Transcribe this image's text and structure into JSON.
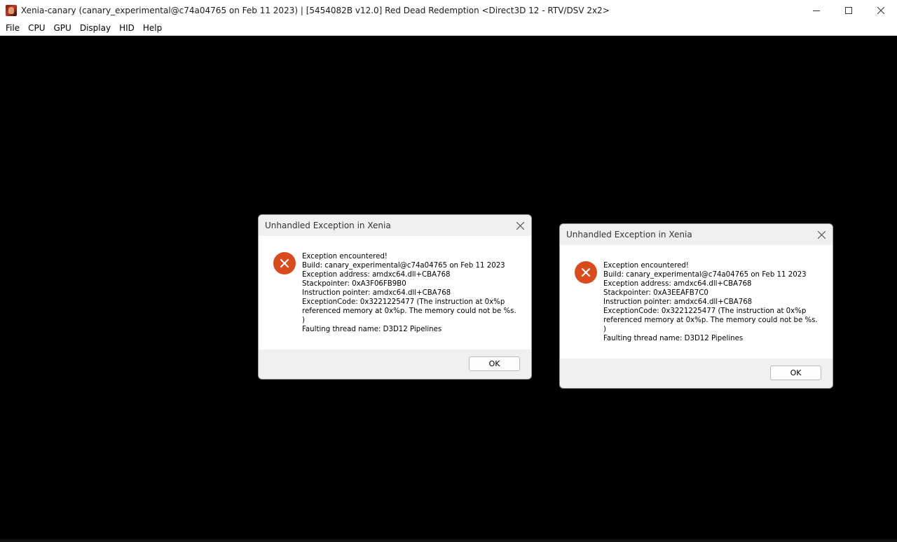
{
  "window": {
    "title": "Xenia-canary (canary_experimental@c74a04765 on Feb 11 2023) | [5454082B v12.0] Red Dead Redemption <Direct3D 12 - RTV/DSV 2x2>",
    "icon": "red-dead-redemption-app-icon"
  },
  "menu": {
    "items": [
      "File",
      "CPU",
      "GPU",
      "Display",
      "HID",
      "Help"
    ]
  },
  "dialogs": [
    {
      "title": "Unhandled Exception in Xenia",
      "icon": "error-icon",
      "lines": [
        "Exception encountered!",
        "Build: canary_experimental@c74a04765 on Feb 11 2023",
        "Exception address: amdxc64.dll+CBA768",
        "Stackpointer: 0xA3F06FB9B0",
        "Instruction pointer: amdxc64.dll+CBA768",
        "ExceptionCode: 0x3221225477 (The instruction at 0x%p",
        "referenced memory at 0x%p. The memory could not be %s.",
        ")",
        "Faulting thread name: D3D12 Pipelines"
      ],
      "ok_label": "OK"
    },
    {
      "title": "Unhandled Exception in Xenia",
      "icon": "error-icon",
      "lines": [
        "Exception encountered!",
        "Build: canary_experimental@c74a04765 on Feb 11 2023",
        "Exception address: amdxc64.dll+CBA768",
        "Stackpointer: 0xA3EEAFB7C0",
        "Instruction pointer: amdxc64.dll+CBA768",
        "ExceptionCode: 0x3221225477 (The instruction at 0x%p",
        "referenced memory at 0x%p. The memory could not be %s.",
        ")",
        "Faulting thread name: D3D12 Pipelines"
      ],
      "ok_label": "OK"
    }
  ],
  "colors": {
    "error_icon": "#d94a1c",
    "viewport": "#000000",
    "dialog_chrome": "#f0f0f0"
  }
}
